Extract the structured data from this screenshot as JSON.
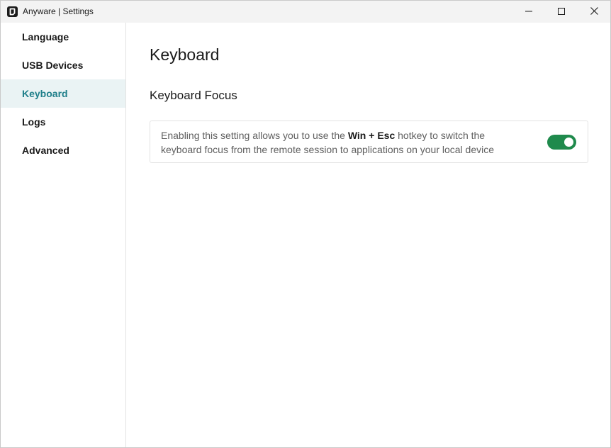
{
  "window": {
    "title": "Anyware | Settings",
    "app_icon": "anyware-logo-icon",
    "controls": [
      "minimize-icon",
      "maximize-icon",
      "close-icon"
    ]
  },
  "sidebar": {
    "items": [
      {
        "label": "Language",
        "active": false
      },
      {
        "label": "USB Devices",
        "active": false
      },
      {
        "label": "Keyboard",
        "active": true
      },
      {
        "label": "Logs",
        "active": false
      },
      {
        "label": "Advanced",
        "active": false
      }
    ],
    "active_color": "#1f7f8a"
  },
  "main": {
    "title": "Keyboard",
    "section_title": "Keyboard Focus",
    "setting": {
      "desc_prefix": "Enabling this setting allows you to use the ",
      "desc_hotkey": "Win + Esc",
      "desc_suffix": " hotkey to switch the keyboard focus from the remote session to applications on your local device",
      "toggle_on": true,
      "toggle_color": "#1f8a4c"
    }
  }
}
